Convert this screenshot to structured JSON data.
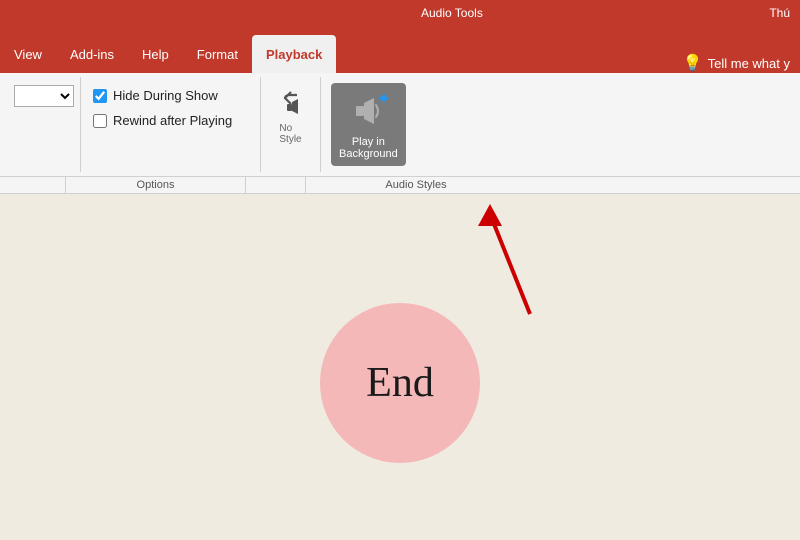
{
  "titleBar": {
    "audioToolsLabel": "Audio Tools",
    "thuLabel": "Thú"
  },
  "ribbonTabs": {
    "tabs": [
      {
        "id": "view",
        "label": "View",
        "active": false
      },
      {
        "id": "addins",
        "label": "Add-ins",
        "active": false
      },
      {
        "id": "help",
        "label": "Help",
        "active": false
      },
      {
        "id": "format",
        "label": "Format",
        "active": false
      },
      {
        "id": "playback",
        "label": "Playback",
        "active": true
      }
    ],
    "tellMe": "Tell me what y",
    "lightbulbIcon": "💡"
  },
  "ribbon": {
    "dropdown": {
      "value": ""
    },
    "checkboxes": [
      {
        "id": "hide-during-show",
        "label": "Hide During Show",
        "checked": true
      },
      {
        "id": "rewind-after-playing",
        "label": "Rewind after Playing",
        "checked": false
      }
    ],
    "optionsLabel": "Options",
    "undoLabel": "No Style",
    "audioStyles": {
      "buttons": [
        {
          "id": "no-style",
          "label": "No\nStyle",
          "active": false
        },
        {
          "id": "play-in-background",
          "label": "Play in\nBackground",
          "active": true
        }
      ],
      "groupLabel": "Audio Styles"
    }
  },
  "slide": {
    "endText": "End",
    "circleColor": "#f4b8b8"
  }
}
